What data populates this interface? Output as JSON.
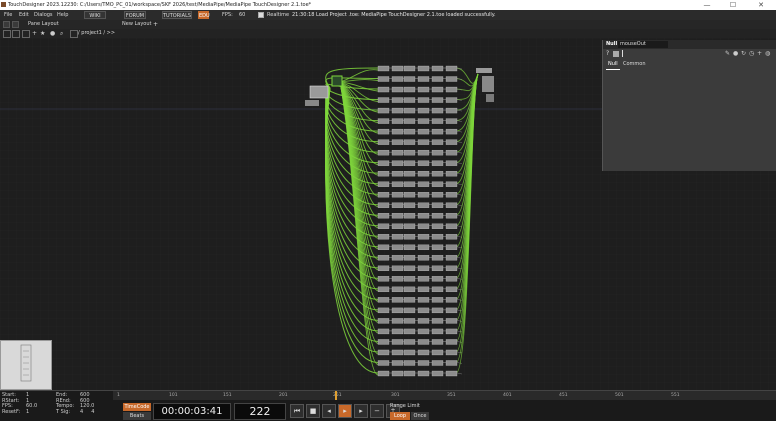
{
  "window": {
    "title": "TouchDesigner 2023.12230: C:/Users/TMO_PC_01/workspace/SKF 2026/test/MediaPipe/MediaPipe TouchDesigner 2.1.toe*",
    "minimize": "—",
    "maximize": "☐",
    "close": "✕"
  },
  "menubar": {
    "menus": [
      "File",
      "Edit",
      "Dialogs",
      "Help"
    ],
    "wiki": "WIKI",
    "forum": "FORUM",
    "tutorials": "TUTORIALS",
    "edu_badge": "EDU",
    "fps_label": "FPS:",
    "fps_value": "60",
    "realtime": "Realtime",
    "status_message": "21:30:18 Load Project .toe: MediaPipe TouchDesigner 2.1.toe loaded successfully."
  },
  "panebar": {
    "pane_layout": "Pane Layout",
    "new_layout": "New Layout",
    "plus": "+"
  },
  "pathbar": {
    "path": "/ project1 / >>"
  },
  "params": {
    "op_type": "Null",
    "op_name": "mouseOut",
    "tabs": [
      "Null",
      "Common"
    ]
  },
  "bottom": {
    "stats_left": [
      [
        "Start:",
        "1"
      ],
      [
        "RStart:",
        "1"
      ],
      [
        "FPS:",
        "60.0"
      ],
      [
        "ResetF:",
        "1"
      ]
    ],
    "stats_right": [
      [
        "End:",
        "600"
      ],
      [
        "REnd:",
        "600"
      ],
      [
        "Tempo:",
        "120.0"
      ],
      [
        "T Sig:",
        "4",
        "4"
      ]
    ],
    "ruler_ticks": [
      "1",
      "101",
      "151",
      "201",
      "251",
      "301",
      "351",
      "401",
      "451",
      "501",
      "551"
    ],
    "timecode_label": "TimeCode",
    "beats_label": "Beats",
    "timecode": "00:00:03:41",
    "frame": "222",
    "range_limit": "Range Limit",
    "loop": "Loop",
    "once": "Once"
  },
  "colors": {
    "wire_green": "#7fd63c",
    "accent_orange": "#c8692a",
    "background": "#1e1e1e"
  }
}
